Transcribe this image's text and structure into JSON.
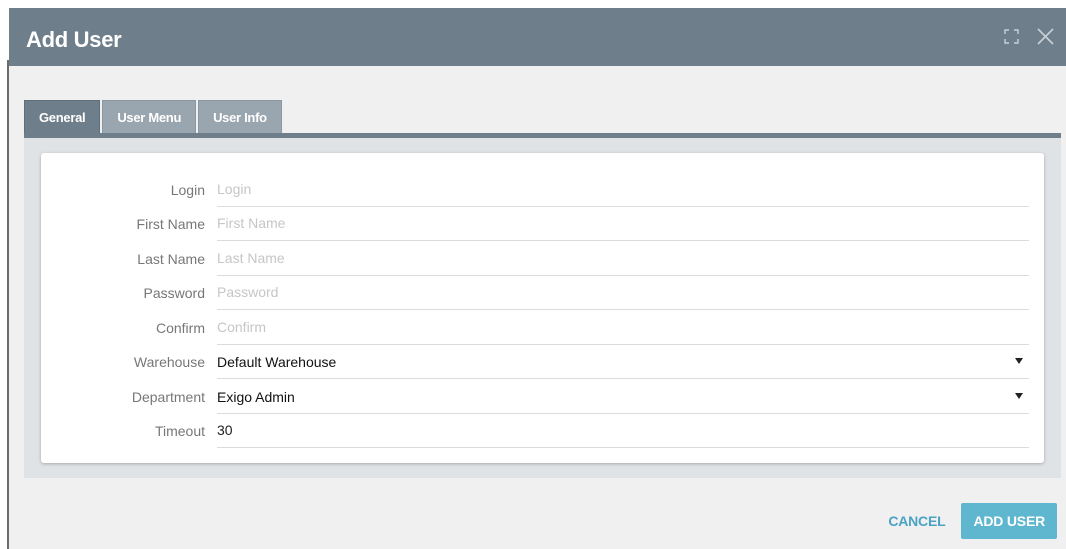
{
  "dialog": {
    "title": "Add User"
  },
  "tabs": [
    {
      "label": "General",
      "active": true
    },
    {
      "label": "User Menu",
      "active": false
    },
    {
      "label": "User Info",
      "active": false
    }
  ],
  "form": {
    "login": {
      "label": "Login",
      "placeholder": "Login",
      "value": ""
    },
    "first_name": {
      "label": "First Name",
      "placeholder": "First Name",
      "value": ""
    },
    "last_name": {
      "label": "Last Name",
      "placeholder": "Last Name",
      "value": ""
    },
    "password": {
      "label": "Password",
      "placeholder": "Password",
      "value": ""
    },
    "confirm": {
      "label": "Confirm",
      "placeholder": "Confirm",
      "value": ""
    },
    "warehouse": {
      "label": "Warehouse",
      "value": "Default Warehouse"
    },
    "department": {
      "label": "Department",
      "value": "Exigo Admin"
    },
    "timeout": {
      "label": "Timeout",
      "value": "30"
    }
  },
  "actions": {
    "cancel_label": "CANCEL",
    "add_user_label": "ADD USER"
  },
  "colors": {
    "titlebar": "#6e7f8b",
    "accent": "#5fb6cf",
    "link": "#4ba3c3"
  },
  "icons": {
    "maximize": "maximize-icon",
    "close": "close-icon",
    "dropdown": "caret-down-icon"
  }
}
